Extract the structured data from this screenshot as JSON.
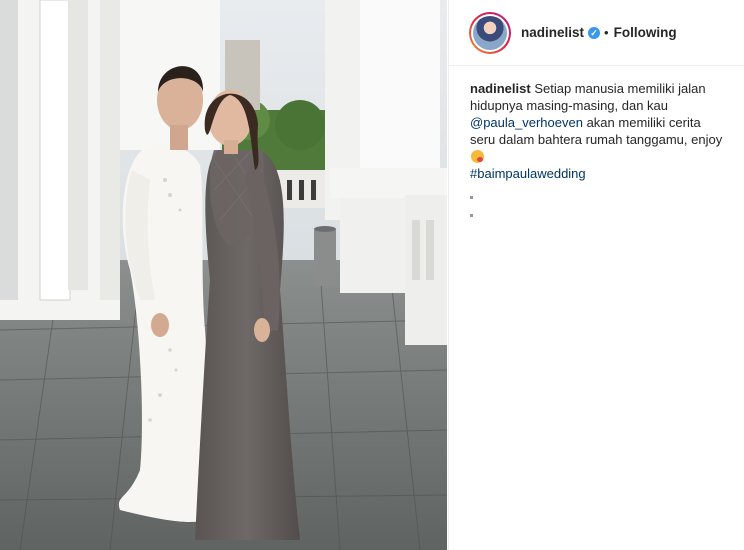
{
  "header": {
    "username": "nadinelist",
    "separator": "•",
    "follow_label": "Following",
    "verified_glyph": "✓"
  },
  "caption": {
    "username": "nadinelist",
    "line1": "Setiap manusia memiliki jalan hidupnya masing-masing, dan kau",
    "mention": "@paula_verhoeven",
    "line2": "akan memiliki cerita seru dalam bahtera rumah tanggamu, enjoy",
    "hashtag": "#baimpaulawedding"
  },
  "icons": {
    "verified": "verified-badge-icon",
    "emoji": "kissing-face-emoji-icon",
    "more": "more-dots-icon"
  },
  "colors": {
    "link": "#003569",
    "text": "#262626",
    "verified": "#3897f0"
  }
}
